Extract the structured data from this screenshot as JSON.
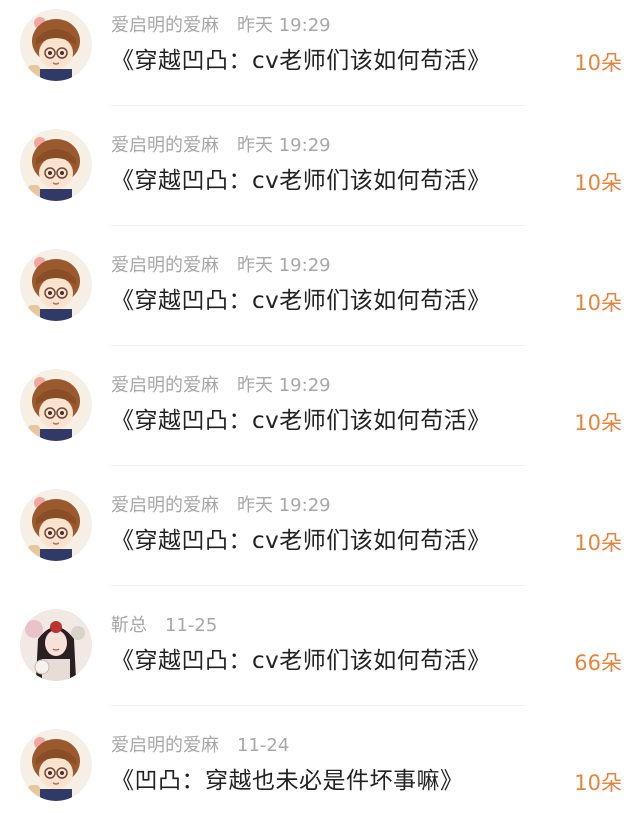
{
  "colors": {
    "meta_text": "#a8a8a8",
    "title_text": "#222222",
    "count_accent": "#e8843a",
    "divider": "#f0f0f0"
  },
  "items": [
    {
      "avatar": "cartoon-boy-avatar",
      "user": "爱启明的爱麻",
      "time": "昨天 19:29",
      "title": "《穿越凹凸：cv老师们该如何苟活》",
      "count": "10朵"
    },
    {
      "avatar": "cartoon-boy-avatar",
      "user": "爱启明的爱麻",
      "time": "昨天 19:29",
      "title": "《穿越凹凸：cv老师们该如何苟活》",
      "count": "10朵"
    },
    {
      "avatar": "cartoon-boy-avatar",
      "user": "爱启明的爱麻",
      "time": "昨天 19:29",
      "title": "《穿越凹凸：cv老师们该如何苟活》",
      "count": "10朵"
    },
    {
      "avatar": "cartoon-boy-avatar",
      "user": "爱启明的爱麻",
      "time": "昨天 19:29",
      "title": "《穿越凹凸：cv老师们该如何苟活》",
      "count": "10朵"
    },
    {
      "avatar": "cartoon-boy-avatar",
      "user": "爱启明的爱麻",
      "time": "昨天 19:29",
      "title": "《穿越凹凸：cv老师们该如何苟活》",
      "count": "10朵"
    },
    {
      "avatar": "costume-girl-avatar",
      "user": "靳总",
      "time": "11-25",
      "title": "《穿越凹凸：cv老师们该如何苟活》",
      "count": "66朵"
    },
    {
      "avatar": "cartoon-boy-avatar",
      "user": "爱启明的爱麻",
      "time": "11-24",
      "title": "《凹凸：穿越也未必是件坏事嘛》",
      "count": "10朵"
    }
  ]
}
